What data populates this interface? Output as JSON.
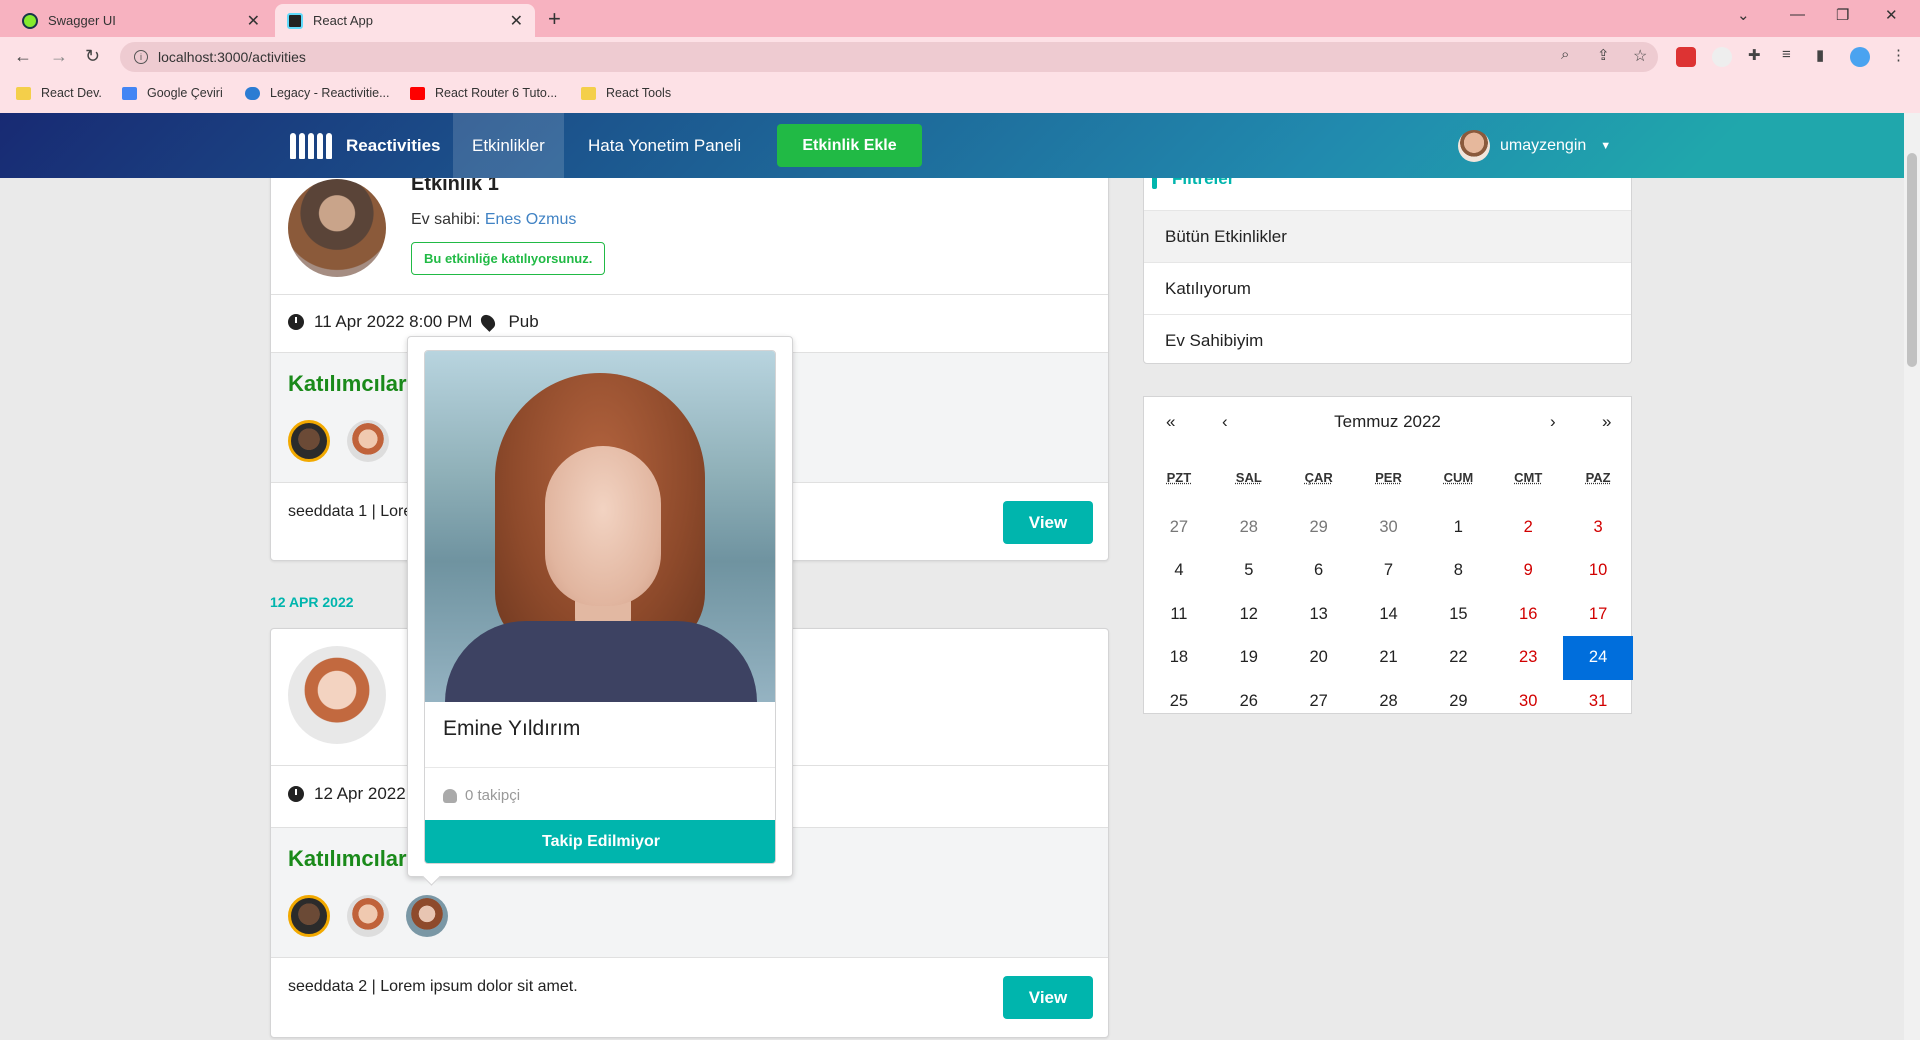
{
  "browser": {
    "tabs": [
      {
        "title": "Swagger UI"
      },
      {
        "title": "React App"
      }
    ],
    "url": "localhost:3000/activities",
    "bookmarks": [
      "React Dev.",
      "Google Çeviri",
      "Legacy - Reactivitie...",
      "React Router 6 Tuto...",
      "React Tools"
    ]
  },
  "navbar": {
    "brand": "Reactivities",
    "items": [
      "Etkinlikler",
      "Hata Yonetim Paneli"
    ],
    "add_button": "Etkinlik Ekle",
    "username": "umayzengin"
  },
  "activities": [
    {
      "title": "Etkinlik 1",
      "host_prefix": "Ev sahibi: ",
      "host": "Enes Ozmus",
      "going_tag": "Bu etkinliğe katılıyorsunuz.",
      "datetime": "11 Apr 2022 8:00 PM",
      "venue": "Pub",
      "attendees_title": "Katılımcılar",
      "description": "seeddata 1 | Lorem ipsum dolor sit amet.",
      "view": "View"
    },
    {
      "date_header": "12 APR 2022",
      "datetime": "12 Apr 2022",
      "attendees_title": "Katılımcılar",
      "description": "seeddata 2 | Lorem ipsum dolor sit amet.",
      "view": "View"
    }
  ],
  "popup": {
    "name": "Emine Yıldırım",
    "followers": "0 takipçi",
    "follow_button": "Takip Edilmiyor"
  },
  "filters": {
    "heading": "Filtreler",
    "items": [
      "Bütün Etkinlikler",
      "Katılıyorum",
      "Ev Sahibiyim"
    ]
  },
  "calendar": {
    "month": "Temmuz 2022",
    "nav": {
      "prev2": "«",
      "prev": "‹",
      "next": "›",
      "next2": "»"
    },
    "weekdays": [
      "PZT",
      "SAL",
      "ÇAR",
      "PER",
      "CUM",
      "CMT",
      "PAZ"
    ],
    "weeks": [
      [
        "27",
        "28",
        "29",
        "30",
        "1",
        "2",
        "3"
      ],
      [
        "4",
        "5",
        "6",
        "7",
        "8",
        "9",
        "10"
      ],
      [
        "11",
        "12",
        "13",
        "14",
        "15",
        "16",
        "17"
      ],
      [
        "18",
        "19",
        "20",
        "21",
        "22",
        "23",
        "24"
      ],
      [
        "25",
        "26",
        "27",
        "28",
        "29",
        "30",
        "31"
      ]
    ],
    "selected": "24",
    "colors": {
      "weekend": "#d10000",
      "selected_bg": "#006edc"
    }
  },
  "colors": {
    "teal": "#00b5ad",
    "green": "#21ba45",
    "link": "#4183c4"
  }
}
